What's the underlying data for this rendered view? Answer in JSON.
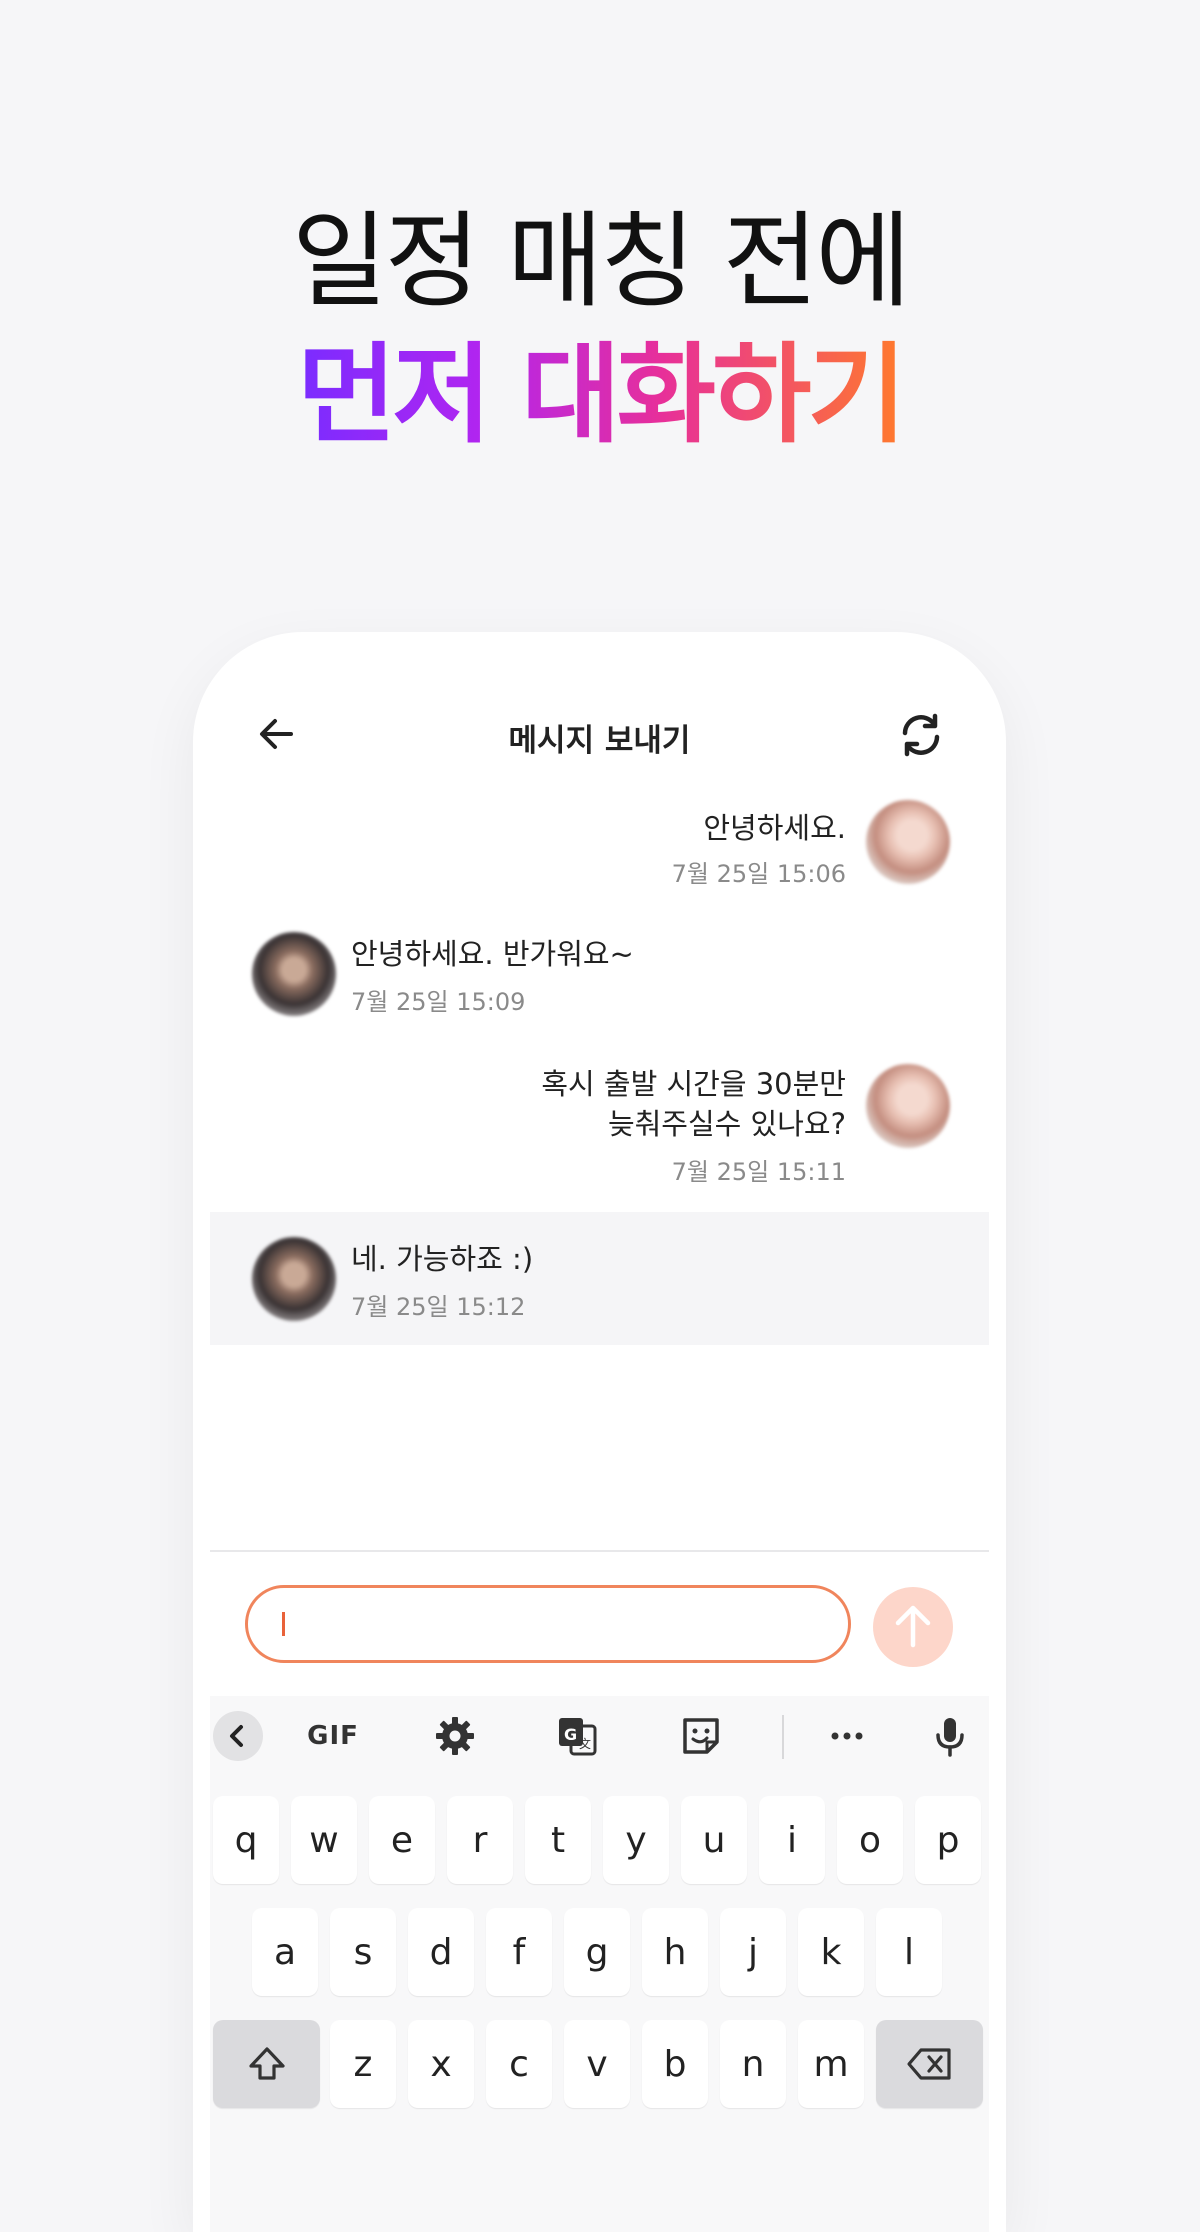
{
  "headline": {
    "line1": "일정 매칭 전에",
    "line2": "먼저 대화하기"
  },
  "appbar": {
    "title": "메시지 보내기",
    "back_icon": "arrow-left-icon",
    "refresh_icon": "refresh-icon"
  },
  "messages": [
    {
      "side": "right",
      "lines": [
        "안녕하세요."
      ],
      "time": "7월 25일 15:06"
    },
    {
      "side": "left",
      "lines": [
        "안녕하세요. 반가워요~"
      ],
      "time": "7월 25일 15:09"
    },
    {
      "side": "right",
      "lines": [
        "혹시 출발 시간을 30분만",
        "늦춰주실수 있나요?"
      ],
      "time": "7월 25일 15:11"
    },
    {
      "side": "left",
      "lines": [
        "네. 가능하죠 :)"
      ],
      "time": "7월 25일 15:12",
      "highlighted": true
    }
  ],
  "composer": {
    "input_value": "",
    "send_icon": "arrow-up-icon"
  },
  "keyboard": {
    "toolbar": {
      "collapse_icon": "chevron-left-icon",
      "gif_label": "GIF",
      "settings_icon": "gear-icon",
      "translate_icon": "translate-icon",
      "sticker_icon": "sticker-icon",
      "more_icon": "more-horizontal-icon",
      "mic_icon": "microphone-icon"
    },
    "row1": [
      "q",
      "w",
      "e",
      "r",
      "t",
      "y",
      "u",
      "i",
      "o",
      "p"
    ],
    "row2": [
      "a",
      "s",
      "d",
      "f",
      "g",
      "h",
      "j",
      "k",
      "l"
    ],
    "row3": [
      "z",
      "x",
      "c",
      "v",
      "b",
      "n",
      "m"
    ],
    "shift_icon": "shift-icon",
    "backspace_icon": "backspace-icon"
  },
  "colors": {
    "accent": "#f0855c",
    "send_bg": "#fdd6ca",
    "gradient": [
      "#7a2cff",
      "#e72f9a",
      "#ff7a2c"
    ]
  }
}
